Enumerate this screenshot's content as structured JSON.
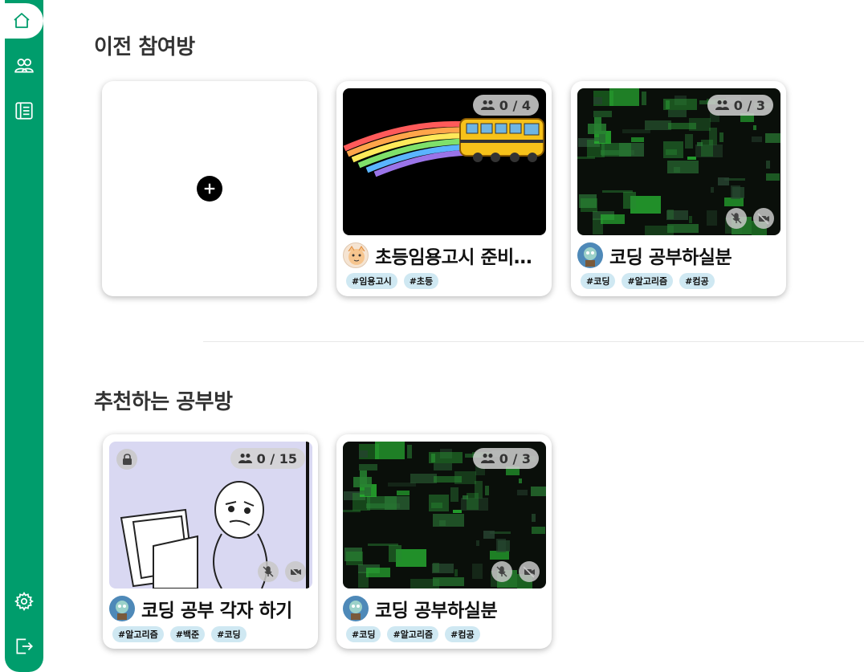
{
  "sidebar": {
    "items": [
      {
        "name": "home-icon"
      },
      {
        "name": "users-icon"
      },
      {
        "name": "notebook-icon"
      }
    ],
    "bottom": [
      {
        "name": "gear-icon"
      },
      {
        "name": "logout-icon"
      }
    ],
    "accent": "#009d6c"
  },
  "sections": {
    "previous_title": "이전 참여방",
    "recommended_title": "추천하는 공부방"
  },
  "previous_rooms": [
    {
      "title": "초등임용고시 준비하는 방",
      "count": "0 / 4",
      "tags": [
        "#임용고시",
        "#초등"
      ],
      "thumbnail": "rainbow-bus"
    },
    {
      "title": "코딩 공부하실분",
      "count": "0 / 3",
      "tags": [
        "#코딩",
        "#알고리즘",
        "#컴공"
      ],
      "thumbnail": "matrix-code"
    }
  ],
  "recommended_rooms": [
    {
      "title": "코딩 공부 각자 하기",
      "count": "0 / 15",
      "tags": [
        "#알고리즘",
        "#백준",
        "#코딩"
      ],
      "thumbnail": "computer-meme",
      "locked": true
    },
    {
      "title": "코딩 공부하실분",
      "count": "0 / 3",
      "tags": [
        "#코딩",
        "#알고리즘",
        "#컴공"
      ],
      "thumbnail": "matrix-code"
    }
  ]
}
